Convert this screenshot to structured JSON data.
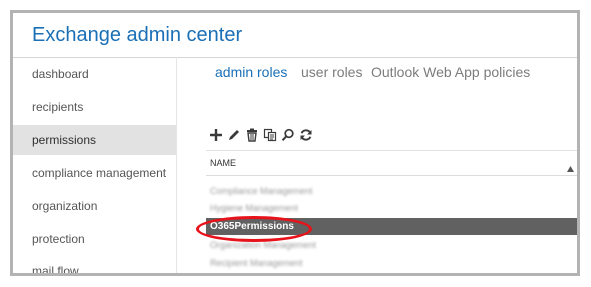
{
  "app": {
    "title": "Exchange admin center"
  },
  "nav": {
    "items": [
      {
        "label": "dashboard",
        "selected": false
      },
      {
        "label": "recipients",
        "selected": false
      },
      {
        "label": "permissions",
        "selected": true
      },
      {
        "label": "compliance management",
        "selected": false
      },
      {
        "label": "organization",
        "selected": false
      },
      {
        "label": "protection",
        "selected": false
      },
      {
        "label": "mail flow",
        "selected": false
      }
    ]
  },
  "tabs": [
    {
      "label": "admin roles",
      "active": true
    },
    {
      "label": "user roles",
      "active": false
    },
    {
      "label": "Outlook Web App policies",
      "active": false
    }
  ],
  "toolbar": {
    "icons": [
      "add-icon",
      "edit-icon",
      "delete-icon",
      "copy-icon",
      "search-icon",
      "refresh-icon"
    ]
  },
  "grid": {
    "column_header": "NAME",
    "sort_icon": "sort-ascending-icon",
    "rows": [
      {
        "name": "Compliance Management",
        "selected": false
      },
      {
        "name": "Hygiene Management",
        "selected": false
      },
      {
        "name": "O365Permissions",
        "selected": true
      },
      {
        "name": "Organization Management",
        "selected": false
      },
      {
        "name": "Recipient Management",
        "selected": false
      }
    ]
  },
  "colors": {
    "accent": "#1a6fb6",
    "selected_row": "#616161",
    "highlight_ring": "#e8121a",
    "nav_selected": "#e2e2e2"
  }
}
